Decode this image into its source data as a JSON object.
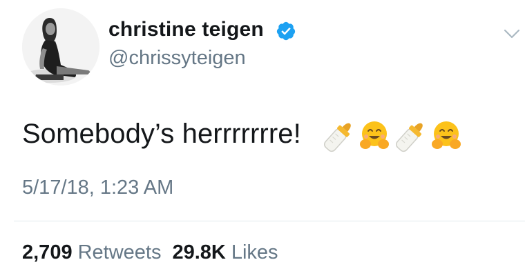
{
  "tweet": {
    "display_name": "christine teigen",
    "handle": "@chrissyteigen",
    "text": "Somebody’s herrrrrrre!",
    "emojis": [
      "baby-bottle-icon",
      "hugging-face-icon",
      "baby-bottle-icon",
      "hugging-face-icon"
    ],
    "timestamp": "5/17/18, 1:23 AM",
    "stats": {
      "retweets_count": "2,709",
      "retweets_label": "Retweets",
      "likes_count": "29.8K",
      "likes_label": "Likes"
    }
  },
  "colors": {
    "verified": "#1da1f2",
    "secondary_text": "#657786",
    "primary_text": "#14171a",
    "divider": "#e1e8ed"
  }
}
